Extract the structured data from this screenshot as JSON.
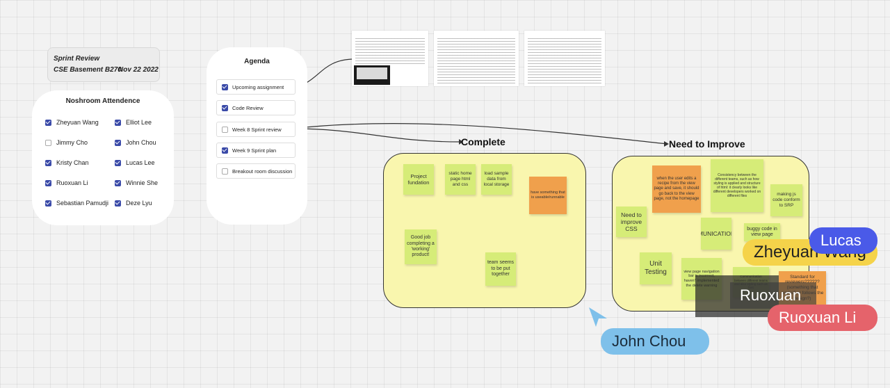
{
  "sprint_review": {
    "title": "Sprint Review",
    "location": "CSE Basement B270",
    "date": "Nov 22 2022"
  },
  "attendance": {
    "title": "Noshroom Attendence",
    "members": [
      {
        "name": "Zheyuan Wang",
        "checked": true
      },
      {
        "name": "Elliot Lee",
        "checked": true
      },
      {
        "name": "Jimmy Cho",
        "checked": false
      },
      {
        "name": "John Chou",
        "checked": true
      },
      {
        "name": "Kristy Chan",
        "checked": true
      },
      {
        "name": "Lucas Lee",
        "checked": true
      },
      {
        "name": "Ruoxuan Li",
        "checked": true
      },
      {
        "name": "Winnie She",
        "checked": true
      },
      {
        "name": "Sebastian Pamudji",
        "checked": true
      },
      {
        "name": "Deze Lyu",
        "checked": true
      }
    ]
  },
  "agenda": {
    "title": "Agenda",
    "items": [
      {
        "label": "Upcoming assignment",
        "checked": true
      },
      {
        "label": "Code Review",
        "checked": true
      },
      {
        "label": "Week 8 Sprint review",
        "checked": false
      },
      {
        "label": "Week 9 Sprint plan",
        "checked": true
      },
      {
        "label": "Breakout room discussion",
        "checked": false
      }
    ]
  },
  "complete": {
    "title": "Complete",
    "notes": [
      "Project fundation",
      "static home page html and css",
      "load sample data from local storage",
      "have something that is useable/runnable",
      "Good job completing a 'working' product!",
      "team seems to be put together"
    ]
  },
  "improve": {
    "title": "Need to Improve",
    "notes": [
      "when the user edits a recipe from the view page and save, it should go back to the view page, not the homepage",
      "Consistency between the different teams, such as how styling is applied and structure of html: it clearly looks like different developers worked on different files",
      "making js code conform to SRP",
      "Need to improve CSS",
      "COMMUNICATION!!!!!!!!",
      "buggy code in view page",
      "Unit Testing",
      "view page navigation bar is incorrect, haven't implemented the delete warning",
      "Communication between different teams and also styling such as font",
      "Standard for reviewers?????? (something that works? or follows the design?)"
    ]
  },
  "cursors": [
    {
      "name": "Lucas",
      "color": "#4a5ae8"
    },
    {
      "name": "Zheyuan Wang",
      "color": "#f5d34a"
    },
    {
      "name": "Ruoxuan",
      "color": "#444444"
    },
    {
      "name": "Ruoxuan Li",
      "color": "#e5636b"
    },
    {
      "name": "John Chou",
      "color": "#7ec0ea"
    }
  ]
}
